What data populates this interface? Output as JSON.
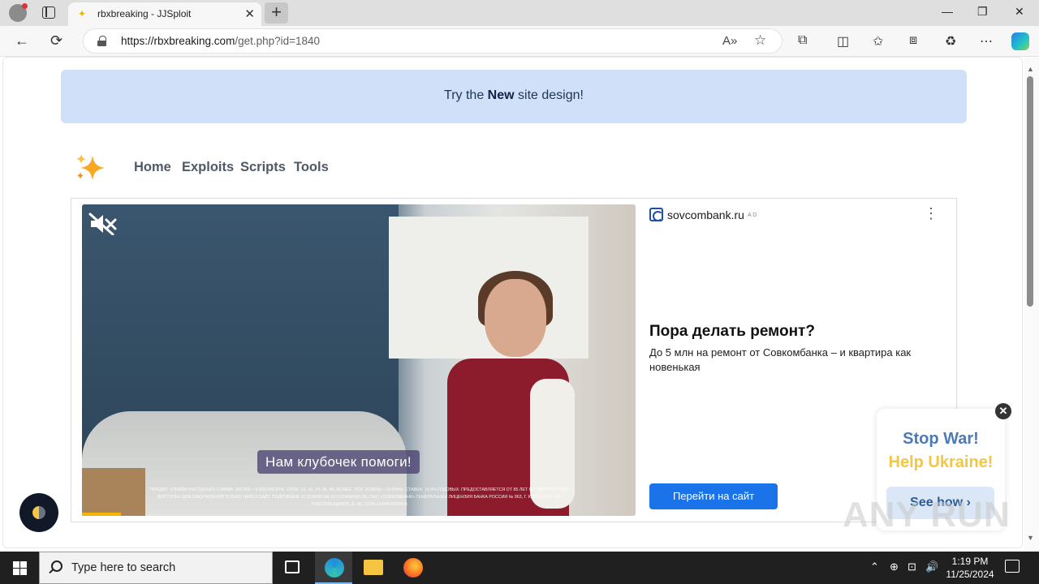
{
  "browser": {
    "tab_title": "rbxbreaking - JJSploit",
    "url_host": "https://rbxbreaking.com",
    "url_path": "/get.php?id=1840",
    "new_tab_glyph": "+",
    "tab_close_glyph": "✕",
    "window_controls": [
      "—",
      "❐",
      "✕"
    ],
    "back_glyph": "←",
    "refresh_glyph": "⟳",
    "read_aloud_glyph": "A»",
    "favorite_glyph": "☆",
    "toolbar_glyphs": [
      "⧉",
      "◫",
      "✩",
      "⧈",
      "♻",
      "⋯"
    ]
  },
  "page": {
    "banner": {
      "prefix": "Try the ",
      "emphasis": "New",
      "suffix": " site design!"
    },
    "nav": [
      "Home",
      "Exploits",
      "Scripts",
      "Tools"
    ],
    "ad": {
      "subtitle": "Нам клубочек помоги!",
      "fine_print": "*КРЕДИТ «ПРАЙМ ВЫГОДНЫЙ» СУММА: 300 000 – 5 000 000 РУБ. СРОК: 12, 18, 24, 36, 48, 60 МЕС. ПСК 14,885% – 19,994%. СТАВКА: 14,9% ГОДОВЫХ. ПРЕДОСТАВЛЯЕТСЯ ОТ 85 ЛЕТ ПО ПАСПОРТУ РФ. ДОСТУПЕН ДЛЯ ОФОРМЛЕНИЯ ТОЛЬКО ЧЕРЕЗ САЙТ. ПОДРОБНЫЕ УСЛОВИЯ НА SOVCOMBANK.RU ПАО «СОВКОМБАНК» ГЕНЕРАЛЬНАЯ ЛИЦЕНЗИЯ БАНКА РОССИИ № 963, Г. КОСТРОМА, ПР. ТЕКСТИЛЬЩИКОВ, Д. 46, ОГРН 1144400000425",
      "advertiser": "sovcombank.ru",
      "ad_tag": "A D",
      "menu_glyph": "⋮",
      "headline": "Пора делать ремонт?",
      "body": "До 5 млн на ремонт от Совкомбанка – и квартира как новенькая",
      "cta": "Перейти на сайт",
      "progress_fraction": 0.07
    },
    "ukraine_popup": {
      "close_glyph": "✕",
      "line1": "Stop War!",
      "line2": "Help Ukraine!",
      "button": "See how ›"
    },
    "watermark": "ANY RUN"
  },
  "taskbar": {
    "search_placeholder": "Type here to search",
    "time": "1:19 PM",
    "date": "11/25/2024",
    "tray_glyphs": [
      "⌃",
      "⊕",
      "⊡",
      "🔊"
    ]
  },
  "colors": {
    "banner_bg": "#cfe0f8",
    "cta": "#1a73e8",
    "ukraine_blue": "#4a7ab8",
    "ukraine_yellow": "#f2c744"
  }
}
